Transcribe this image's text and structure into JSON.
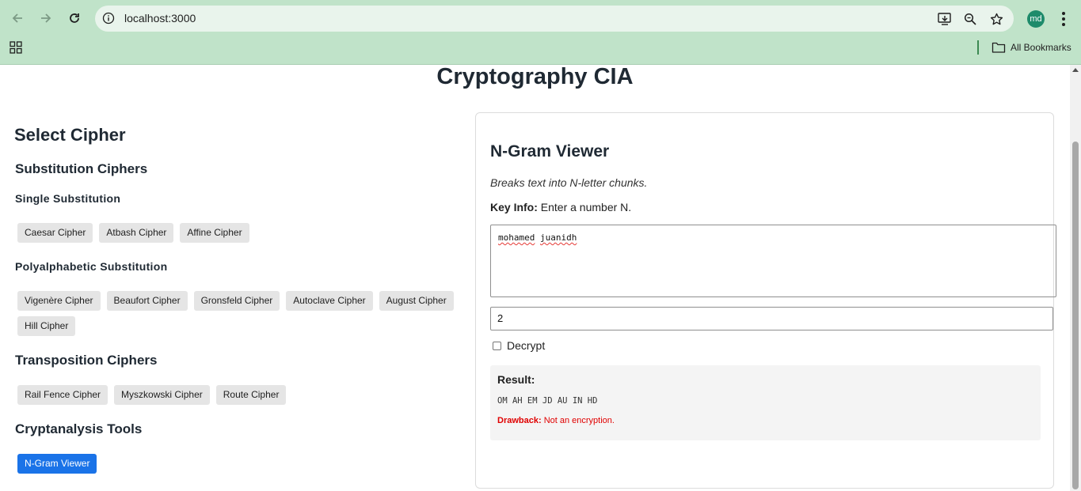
{
  "browser": {
    "url": "localhost:3000",
    "avatar_initials": "md",
    "bookmarks_label": "All Bookmarks"
  },
  "page": {
    "title": "Cryptography CIA"
  },
  "sidebar": {
    "heading": "Select Cipher",
    "substitution": {
      "heading": "Substitution Ciphers",
      "single": {
        "heading": "Single Substitution",
        "buttons": [
          "Caesar Cipher",
          "Atbash Cipher",
          "Affine Cipher"
        ]
      },
      "poly": {
        "heading": "Polyalphabetic Substitution",
        "buttons": [
          "Vigenère Cipher",
          "Beaufort Cipher",
          "Gronsfeld Cipher",
          "Autoclave Cipher",
          "August Cipher",
          "Hill Cipher"
        ]
      }
    },
    "transposition": {
      "heading": "Transposition Ciphers",
      "buttons": [
        "Rail Fence Cipher",
        "Myszkowski Cipher",
        "Route Cipher"
      ]
    },
    "cryptanalysis": {
      "heading": "Cryptanalysis Tools",
      "buttons": [
        "N-Gram Viewer"
      ]
    }
  },
  "panel": {
    "title": "N-Gram Viewer",
    "description": "Breaks text into N-letter chunks.",
    "key_info_label": "Key Info:",
    "key_info_text": " Enter a number N.",
    "input_text_word1": "mohamed",
    "input_text_space": " ",
    "input_text_word2": "juanidh",
    "n_value": "2",
    "decrypt_label": "Decrypt",
    "decrypt_checked": false,
    "result_label": "Result:",
    "result_output": "OM AH EM JD AU IN HD",
    "drawback_label": "Drawback:",
    "drawback_text": " Not an encryption."
  },
  "colors": {
    "browser_toolbar": "#c0e3c9",
    "active_button": "#1a73e8",
    "button_bg": "#e5e5e5",
    "drawback": "#e00000"
  }
}
